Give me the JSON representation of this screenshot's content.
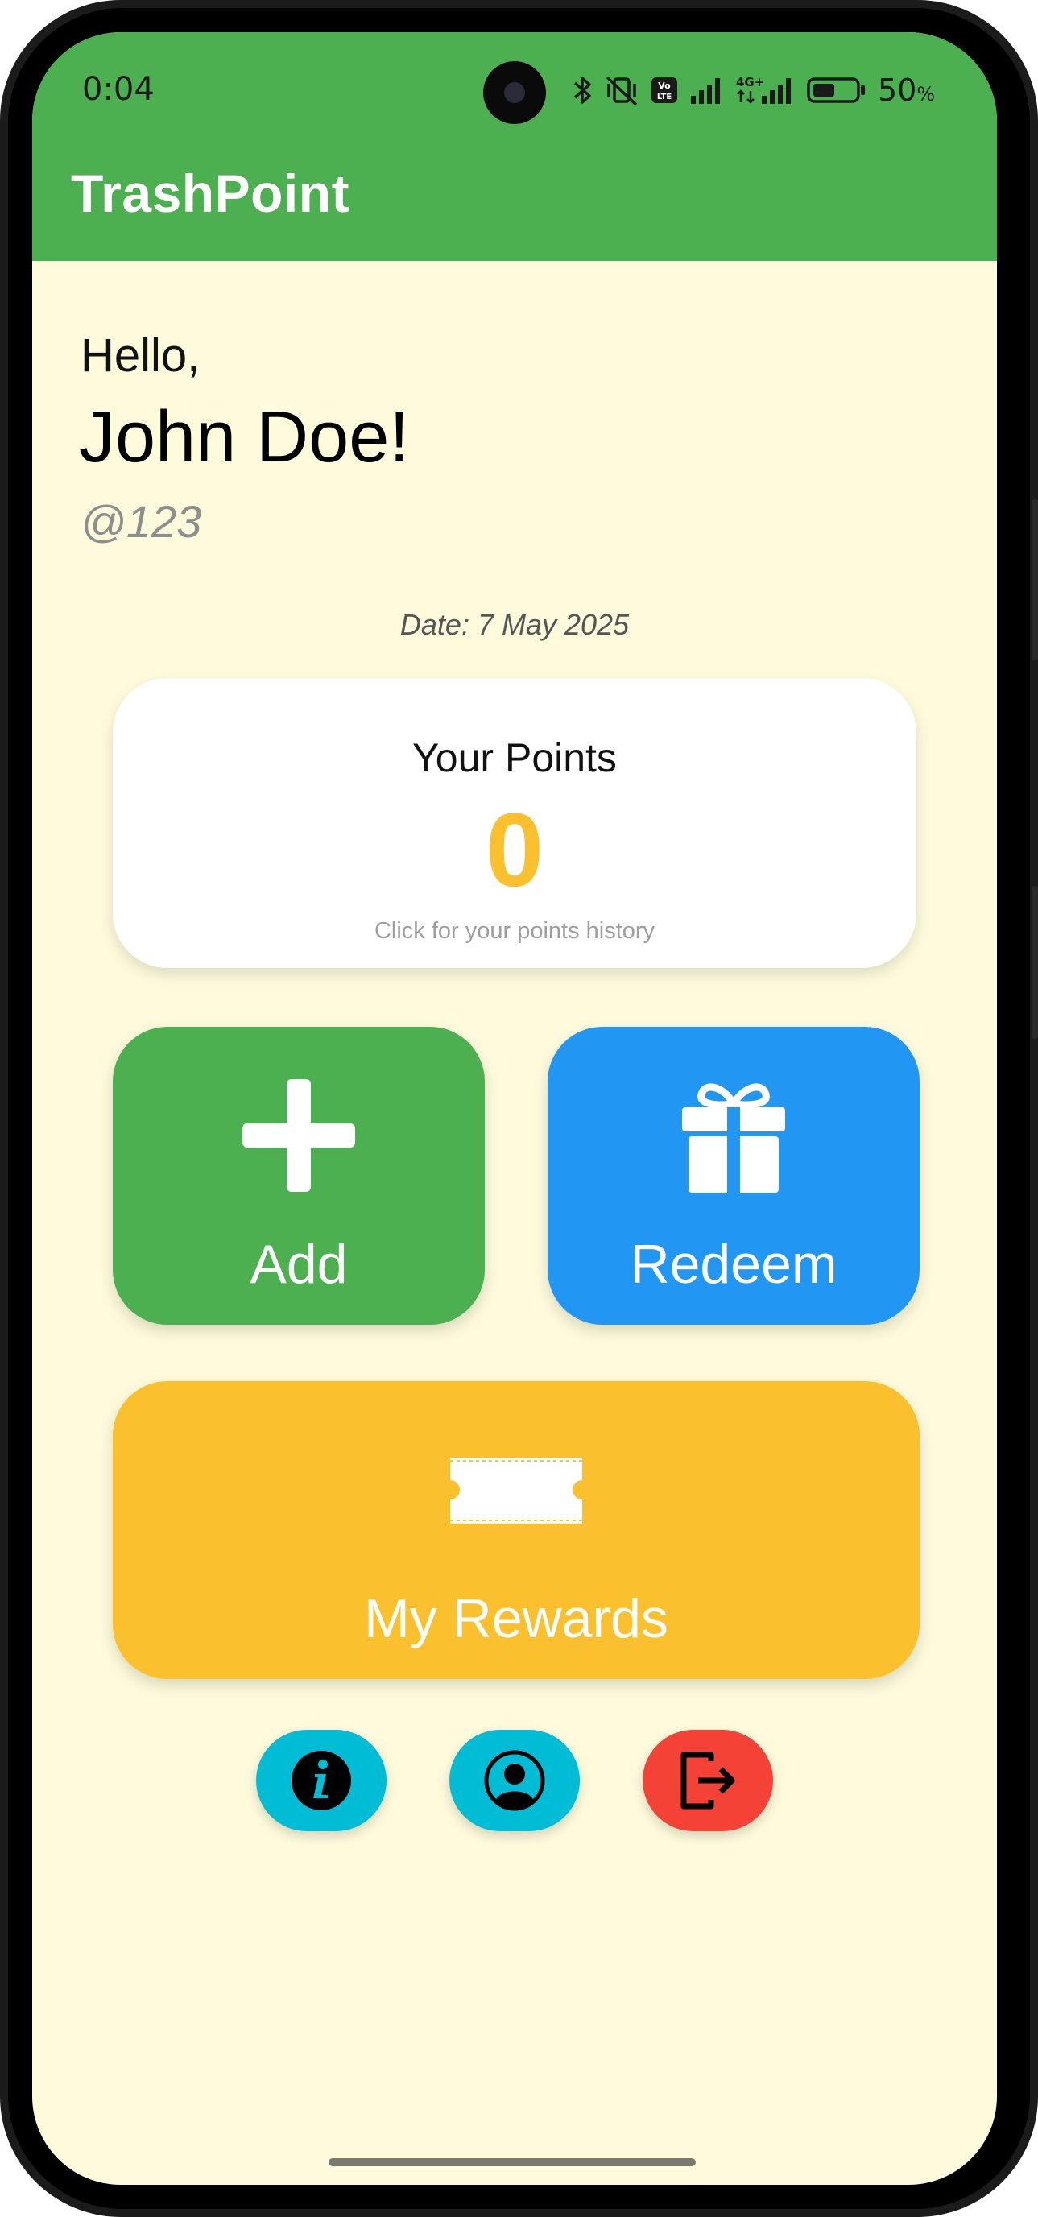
{
  "status_bar": {
    "time": "0:04",
    "battery_level": "50",
    "battery_unit": "%",
    "network_label": "4G+",
    "volte_label": "Vo LTE",
    "icons": [
      "bluetooth-icon",
      "mute-vibrate-icon",
      "volte-icon",
      "signal-icon",
      "signal-4g-icon",
      "battery-icon"
    ]
  },
  "app_bar": {
    "title": "TrashPoint",
    "color": "#4caf50"
  },
  "greeting": {
    "hello": "Hello,",
    "name": "John Doe!",
    "handle": "@123"
  },
  "date": "Date: 7 May 2025",
  "points_card": {
    "title": "Your Points",
    "value": "0",
    "hint": "Click for your points history",
    "value_color": "#fbc02d"
  },
  "actions": {
    "add": {
      "label": "Add",
      "icon": "plus-icon",
      "color": "#4caf50"
    },
    "redeem": {
      "label": "Redeem",
      "icon": "gift-icon",
      "color": "#2196f3"
    },
    "rewards": {
      "label": "My Rewards",
      "icon": "ticket-icon",
      "color": "#fbc02d"
    }
  },
  "bottom_buttons": [
    {
      "name": "info",
      "icon": "info-icon",
      "color": "#00bcd4"
    },
    {
      "name": "profile",
      "icon": "account-circle-icon",
      "color": "#00bcd4"
    },
    {
      "name": "logout",
      "icon": "logout-icon",
      "color": "#f44336"
    }
  ],
  "colors": {
    "background": "#fdfbdb",
    "card": "#ffffff"
  }
}
